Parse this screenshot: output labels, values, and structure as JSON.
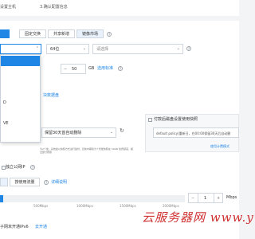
{
  "steps": {
    "current": "设置主机",
    "next": "3.确认配置信息"
  },
  "disk_tabs": {
    "tab2": "固定交换",
    "tab3": "共享新增",
    "tab4": "镜像市场"
  },
  "system_disk": {
    "arch": "64位",
    "image_placeholder": "请选择",
    "size": "50",
    "unit": "GB",
    "link": "选用标准"
  },
  "dropdown": {
    "items": [
      "",
      "",
      "",
      "",
      "D",
      "",
      "VE",
      ""
    ]
  },
  "data_disk": {
    "label": "块数据盘"
  },
  "snapshot": {
    "left_value": "保留30天首自动删除",
    "note": "为2个盘，系统盘以快照方式进行备份，目前中期和为个智能快照在 50GB 免费额度，超出部分按照",
    "right_label": "付款后磁盘设置使用快照",
    "right_value": "default policy(重新日，在00:00保留30天后自动删",
    "right_link": "使用计费模式"
  },
  "public_ip": {
    "label": "独立公网IP",
    "billing_button": "按使用流量",
    "link": "详细说明",
    "scale": [
      "500Mbps",
      "1000Mbps",
      "1500Mbps",
      "2000Mbps"
    ],
    "value": "1",
    "unit": "Mbps"
  },
  "ipv6": {
    "text": "子网未开通IPv6",
    "link": "去开通"
  },
  "watermark": "云服务器网 www.yu"
}
